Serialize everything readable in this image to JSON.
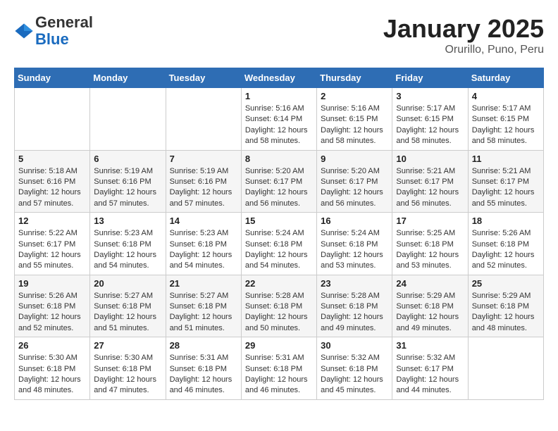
{
  "header": {
    "logo": {
      "general": "General",
      "blue": "Blue"
    },
    "title": "January 2025",
    "location": "Orurillo, Puno, Peru"
  },
  "calendar": {
    "weekdays": [
      "Sunday",
      "Monday",
      "Tuesday",
      "Wednesday",
      "Thursday",
      "Friday",
      "Saturday"
    ],
    "weeks": [
      [
        {
          "day": "",
          "info": ""
        },
        {
          "day": "",
          "info": ""
        },
        {
          "day": "",
          "info": ""
        },
        {
          "day": "1",
          "info": "Sunrise: 5:16 AM\nSunset: 6:14 PM\nDaylight: 12 hours\nand 58 minutes."
        },
        {
          "day": "2",
          "info": "Sunrise: 5:16 AM\nSunset: 6:15 PM\nDaylight: 12 hours\nand 58 minutes."
        },
        {
          "day": "3",
          "info": "Sunrise: 5:17 AM\nSunset: 6:15 PM\nDaylight: 12 hours\nand 58 minutes."
        },
        {
          "day": "4",
          "info": "Sunrise: 5:17 AM\nSunset: 6:15 PM\nDaylight: 12 hours\nand 58 minutes."
        }
      ],
      [
        {
          "day": "5",
          "info": "Sunrise: 5:18 AM\nSunset: 6:16 PM\nDaylight: 12 hours\nand 57 minutes."
        },
        {
          "day": "6",
          "info": "Sunrise: 5:19 AM\nSunset: 6:16 PM\nDaylight: 12 hours\nand 57 minutes."
        },
        {
          "day": "7",
          "info": "Sunrise: 5:19 AM\nSunset: 6:16 PM\nDaylight: 12 hours\nand 57 minutes."
        },
        {
          "day": "8",
          "info": "Sunrise: 5:20 AM\nSunset: 6:17 PM\nDaylight: 12 hours\nand 56 minutes."
        },
        {
          "day": "9",
          "info": "Sunrise: 5:20 AM\nSunset: 6:17 PM\nDaylight: 12 hours\nand 56 minutes."
        },
        {
          "day": "10",
          "info": "Sunrise: 5:21 AM\nSunset: 6:17 PM\nDaylight: 12 hours\nand 56 minutes."
        },
        {
          "day": "11",
          "info": "Sunrise: 5:21 AM\nSunset: 6:17 PM\nDaylight: 12 hours\nand 55 minutes."
        }
      ],
      [
        {
          "day": "12",
          "info": "Sunrise: 5:22 AM\nSunset: 6:17 PM\nDaylight: 12 hours\nand 55 minutes."
        },
        {
          "day": "13",
          "info": "Sunrise: 5:23 AM\nSunset: 6:18 PM\nDaylight: 12 hours\nand 54 minutes."
        },
        {
          "day": "14",
          "info": "Sunrise: 5:23 AM\nSunset: 6:18 PM\nDaylight: 12 hours\nand 54 minutes."
        },
        {
          "day": "15",
          "info": "Sunrise: 5:24 AM\nSunset: 6:18 PM\nDaylight: 12 hours\nand 54 minutes."
        },
        {
          "day": "16",
          "info": "Sunrise: 5:24 AM\nSunset: 6:18 PM\nDaylight: 12 hours\nand 53 minutes."
        },
        {
          "day": "17",
          "info": "Sunrise: 5:25 AM\nSunset: 6:18 PM\nDaylight: 12 hours\nand 53 minutes."
        },
        {
          "day": "18",
          "info": "Sunrise: 5:26 AM\nSunset: 6:18 PM\nDaylight: 12 hours\nand 52 minutes."
        }
      ],
      [
        {
          "day": "19",
          "info": "Sunrise: 5:26 AM\nSunset: 6:18 PM\nDaylight: 12 hours\nand 52 minutes."
        },
        {
          "day": "20",
          "info": "Sunrise: 5:27 AM\nSunset: 6:18 PM\nDaylight: 12 hours\nand 51 minutes."
        },
        {
          "day": "21",
          "info": "Sunrise: 5:27 AM\nSunset: 6:18 PM\nDaylight: 12 hours\nand 51 minutes."
        },
        {
          "day": "22",
          "info": "Sunrise: 5:28 AM\nSunset: 6:18 PM\nDaylight: 12 hours\nand 50 minutes."
        },
        {
          "day": "23",
          "info": "Sunrise: 5:28 AM\nSunset: 6:18 PM\nDaylight: 12 hours\nand 49 minutes."
        },
        {
          "day": "24",
          "info": "Sunrise: 5:29 AM\nSunset: 6:18 PM\nDaylight: 12 hours\nand 49 minutes."
        },
        {
          "day": "25",
          "info": "Sunrise: 5:29 AM\nSunset: 6:18 PM\nDaylight: 12 hours\nand 48 minutes."
        }
      ],
      [
        {
          "day": "26",
          "info": "Sunrise: 5:30 AM\nSunset: 6:18 PM\nDaylight: 12 hours\nand 48 minutes."
        },
        {
          "day": "27",
          "info": "Sunrise: 5:30 AM\nSunset: 6:18 PM\nDaylight: 12 hours\nand 47 minutes."
        },
        {
          "day": "28",
          "info": "Sunrise: 5:31 AM\nSunset: 6:18 PM\nDaylight: 12 hours\nand 46 minutes."
        },
        {
          "day": "29",
          "info": "Sunrise: 5:31 AM\nSunset: 6:18 PM\nDaylight: 12 hours\nand 46 minutes."
        },
        {
          "day": "30",
          "info": "Sunrise: 5:32 AM\nSunset: 6:18 PM\nDaylight: 12 hours\nand 45 minutes."
        },
        {
          "day": "31",
          "info": "Sunrise: 5:32 AM\nSunset: 6:17 PM\nDaylight: 12 hours\nand 44 minutes."
        },
        {
          "day": "",
          "info": ""
        }
      ]
    ]
  }
}
